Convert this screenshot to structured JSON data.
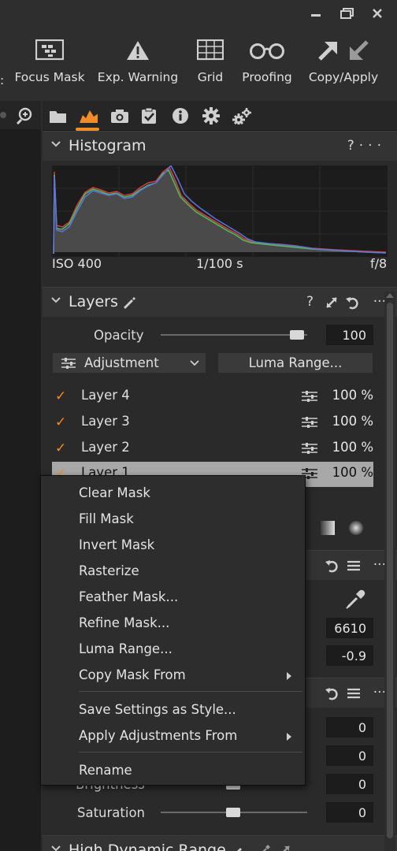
{
  "window": {
    "minimize_glyph": "▬",
    "restore_glyph": "❐",
    "close_glyph": "✕"
  },
  "toolbar": {
    "items": [
      {
        "label": "Focus Mask",
        "icon": "focus-mask-icon"
      },
      {
        "label": "Exp. Warning",
        "icon": "exposure-warning-icon"
      },
      {
        "label": "Grid",
        "icon": "grid-icon"
      },
      {
        "label": "Proofing",
        "icon": "proofing-glasses-icon"
      },
      {
        "label": "Copy/Apply",
        "icon": "copy-apply-arrows-icon"
      }
    ],
    "leading_fragment": ":"
  },
  "tool_tabs": [
    {
      "icon": "folder-icon",
      "active": false
    },
    {
      "icon": "exposure-tab-icon",
      "active": true
    },
    {
      "icon": "camera-icon",
      "active": false
    },
    {
      "icon": "clipboard-icon",
      "active": false
    },
    {
      "icon": "info-icon",
      "active": false
    },
    {
      "icon": "gear-icon",
      "active": false
    },
    {
      "icon": "gears-icon",
      "active": false
    }
  ],
  "histogram": {
    "title": "Histogram",
    "help": "?",
    "more": "···",
    "iso": "ISO 400",
    "shutter": "1/100 s",
    "aperture": "f/8"
  },
  "layers": {
    "title": "Layers",
    "help": "?",
    "more": "···",
    "opacity_label": "Opacity",
    "opacity_value": "100",
    "opacity_level": 1.0,
    "adjustment_label": "Adjustment",
    "luma_range_button": "Luma Range...",
    "items": [
      {
        "name": "Layer 4",
        "opacity": "100 %",
        "checked": true
      },
      {
        "name": "Layer 3",
        "opacity": "100 %",
        "checked": true
      },
      {
        "name": "Layer 2",
        "opacity": "100 %",
        "checked": true
      },
      {
        "name": "Layer 1",
        "opacity": "100 %",
        "checked": true,
        "selected": true
      }
    ]
  },
  "white_balance": {
    "kelvin_value": "6610",
    "tint_value": "-0.9"
  },
  "exposure": {
    "values": [
      "0",
      "0",
      "0"
    ],
    "brightness_label": "Brightness",
    "saturation_label": "Saturation",
    "saturation_value": "0"
  },
  "hdr": {
    "title": "High Dynamic Range"
  },
  "context_menu": {
    "items": [
      {
        "label": "Clear Mask"
      },
      {
        "label": "Fill Mask"
      },
      {
        "label": "Invert Mask"
      },
      {
        "label": "Rasterize"
      },
      {
        "label": "Feather Mask..."
      },
      {
        "label": "Refine Mask..."
      },
      {
        "label": "Luma Range..."
      },
      {
        "label": "Copy Mask From",
        "submenu": true
      },
      {
        "label": "Save Settings as Style..."
      },
      {
        "label": "Apply Adjustments From",
        "submenu": true
      },
      {
        "label": "Rename"
      }
    ]
  },
  "colors": {
    "accent": "#f28c28",
    "panel": "#2a2a2a",
    "header": "#333333",
    "selected_row": "#a8a8a8"
  }
}
